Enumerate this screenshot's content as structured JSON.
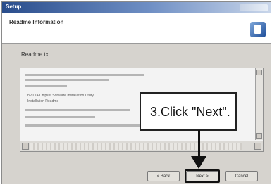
{
  "window": {
    "title": "Setup",
    "header_title": "Readme Information",
    "section_label": "Readme.txt"
  },
  "readme": {
    "lines": [
      "nVIDIA Chipset Software Installation Utility",
      "Installation Readme"
    ]
  },
  "buttons": {
    "back": "< Back",
    "next": "Next >",
    "cancel": "Cancel"
  },
  "callout": {
    "text": "3.Click \"Next\"."
  }
}
